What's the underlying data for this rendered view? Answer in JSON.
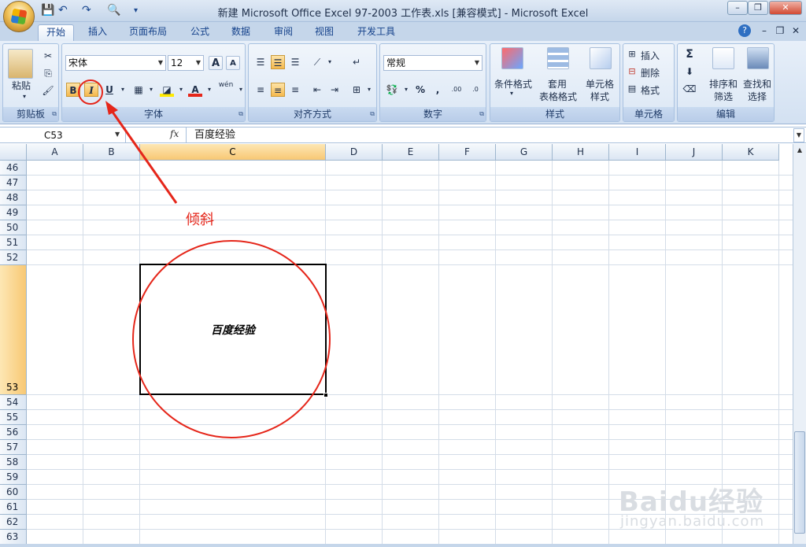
{
  "window": {
    "title": "新建 Microsoft Office Excel 97-2003 工作表.xls  [兼容模式] - Microsoft Excel",
    "minimize": "–",
    "restore": "❐",
    "close": "✕"
  },
  "qat": {
    "save": "💾",
    "undo": "↶",
    "redo": "↷",
    "preview": "🔍",
    "more": "▾"
  },
  "tabs": [
    "开始",
    "插入",
    "页面布局",
    "公式",
    "数据",
    "审阅",
    "视图",
    "开发工具"
  ],
  "ribbon_right": {
    "help": "?",
    "min": "–",
    "restore": "❐",
    "close": "✕"
  },
  "clipboard": {
    "paste_label": "粘贴",
    "group_label": "剪贴板"
  },
  "font": {
    "font_name": "宋体",
    "font_size": "12",
    "grow": "A",
    "shrink": "A",
    "bold": "B",
    "italic": "I",
    "underline": "U",
    "border": "▦",
    "fill": "◪",
    "color": "A",
    "phonetic": "wén",
    "group_label": "字体"
  },
  "alignment": {
    "group_label": "对齐方式"
  },
  "number": {
    "format": "常规",
    "percent": "%",
    "comma": ",",
    "inc": ".00",
    "dec": ".0",
    "group_label": "数字"
  },
  "styles": {
    "conditional": "条件格式",
    "table_line1": "套用",
    "table_line2": "表格格式",
    "cell_line1": "单元格",
    "cell_line2": "样式",
    "group_label": "样式"
  },
  "cells": {
    "insert": "插入",
    "delete": "删除",
    "format": "格式",
    "group_label": "单元格"
  },
  "editing": {
    "sigma": "Σ",
    "sort_line1": "排序和",
    "sort_line2": "筛选",
    "find_line1": "查找和",
    "find_line2": "选择",
    "group_label": "编辑"
  },
  "formula_bar": {
    "name_box": "C53",
    "fx": "fx",
    "content": "百度经验"
  },
  "columns": [
    "A",
    "B",
    "C",
    "D",
    "E",
    "F",
    "G",
    "H",
    "I",
    "J",
    "K"
  ],
  "rows": [
    "46",
    "47",
    "48",
    "49",
    "50",
    "51",
    "52",
    "53",
    "54",
    "55",
    "56",
    "57",
    "58",
    "59",
    "60",
    "61",
    "62",
    "63"
  ],
  "selected_cell": {
    "ref": "C53",
    "text": "百度经验"
  },
  "annotation": {
    "label": "倾斜",
    "color": "#e5261a"
  },
  "watermark": {
    "main": "Baidu经验",
    "sub": "jingyan.baidu.com"
  }
}
